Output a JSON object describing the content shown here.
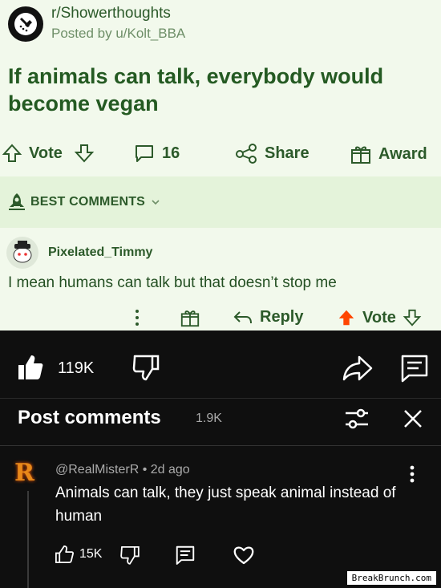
{
  "reddit": {
    "subreddit": "r/Showerthoughts",
    "posted_by": "Posted by u/Kolt_BBA",
    "title": "If animals can talk, everybody would become vegan",
    "actions": {
      "vote": "Vote",
      "comments_count": "16",
      "share": "Share",
      "award": "Award"
    },
    "best_comments_label": "BEST COMMENTS",
    "comment": {
      "username": "Pixelated_Timmy",
      "text": "I mean humans can talk but that doesn’t stop me",
      "reply": "Reply",
      "vote": "Vote"
    }
  },
  "youtube": {
    "like_count": "119K",
    "comments_title": "Post comments",
    "comments_count": "1.9K",
    "comment": {
      "avatar_letter": "R",
      "handle": "@RealMisterR",
      "age": "• 2d ago",
      "text": "Animals can talk, they just speak animal instead of human",
      "likes": "15K"
    }
  },
  "watermark": "BreakBrunch.com",
  "colors": {
    "reddit_bg": "#f2f9ec",
    "reddit_text": "#2c5a2a",
    "upvote_orange": "#ff4500",
    "yt_bg": "#0f0f0f"
  }
}
